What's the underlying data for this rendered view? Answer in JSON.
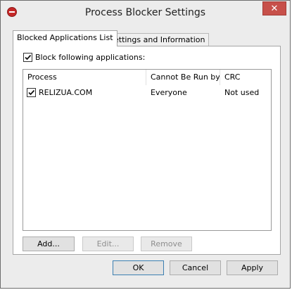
{
  "window": {
    "title": "Process Blocker Settings",
    "close_glyph": "✕"
  },
  "tabs": [
    {
      "label": "Blocked Applications List"
    },
    {
      "label": "Settings and Information"
    }
  ],
  "block": {
    "label": "Block following applications:",
    "checked": true
  },
  "list": {
    "columns": [
      "Process",
      "Cannot Be Run by",
      "CRC"
    ],
    "rows": [
      {
        "checked": true,
        "process": "RELIZUA.COM",
        "run_by": "Everyone",
        "crc": "Not used"
      }
    ]
  },
  "list_buttons": {
    "add": "Add...",
    "edit": "Edit...",
    "remove": "Remove"
  },
  "dialog_buttons": {
    "ok": "OK",
    "cancel": "Cancel",
    "apply": "Apply"
  },
  "colors": {
    "close_button": "#c7504a",
    "app_icon": "#c62828"
  }
}
